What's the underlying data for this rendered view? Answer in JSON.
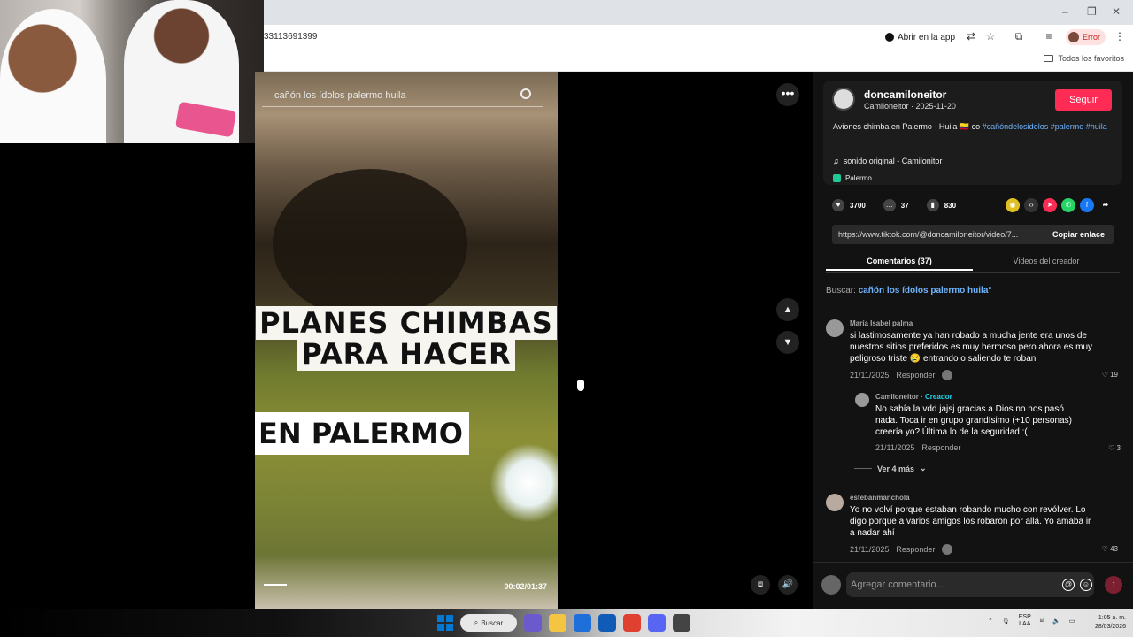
{
  "browser": {
    "url": "33113691399",
    "open_app": "Abrir en la app",
    "profile_status": "Error",
    "bookmarks_folder": "Todos los favoritos"
  },
  "video": {
    "search_text": "cañón los ídolos palermo huila",
    "overlay_line1": "PLANES CHIMBAS",
    "overlay_line2": "PARA HACER",
    "overlay_line3": "EN PALERMO",
    "timecode": "00:02/01:37",
    "progress_fraction": 0.02
  },
  "post": {
    "author": "doncamiloneitor",
    "author_sub": "Camiloneitor · 2025-11-20",
    "follow": "Seguir",
    "desc_text": "Aviones chimba en Palermo - Huila 🇨🇴 co",
    "desc_tags": "#cañóndelosidolos #palermo #huila",
    "sound": "sonido original - Camilonitor",
    "location": "Palermo",
    "likes": "3700",
    "comments": "37",
    "saves": "830",
    "link": "https://www.tiktok.com/@doncamiloneitor/video/7...",
    "copy_link": "Copiar enlace"
  },
  "tabs": {
    "comments": "Comentarios (37)",
    "creator_videos": "Videos del creador"
  },
  "search": {
    "label": "Buscar:",
    "query": "cañón los ídolos palermo huila"
  },
  "comments": [
    {
      "name": "María Isabel palma",
      "text": "si lastimosamente ya han robado a mucha jente era unos de nuestros sitios preferidos es muy hermoso pero ahora es muy peligroso triste 😢 entrando o saliendo te roban",
      "date": "21/11/2025",
      "reply": "Responder",
      "likes": "19"
    },
    {
      "name": "Camiloneitor",
      "badge": "· Creador",
      "text": "No sabía la vdd jajsj gracias a Dios no nos pasó nada. Toca ir en grupo grandísimo (+10 personas) creería yo? Última lo de la seguridad :(",
      "date": "21/11/2025",
      "reply": "Responder",
      "likes": "3"
    },
    {
      "name": "estebanmanchola",
      "text": "Yo no volví porque estaban robando mucho con revólver. Lo digo porque a varios amigos los robaron por allá. Yo amaba ir a nadar ahí",
      "date": "21/11/2025",
      "reply": "Responder",
      "likes": "43"
    }
  ],
  "more_replies": "Ver 4 más",
  "composer": {
    "placeholder": "Agregar comentario..."
  },
  "taskbar": {
    "search": "Buscar",
    "lang_top": "ESP",
    "lang_bottom": "LAA",
    "time": "1:05 a. m.",
    "date": "28/03/2026"
  },
  "colors": {
    "accent": "#fe2c55",
    "link": "#6fb4ff",
    "creator": "#20d5ec"
  }
}
